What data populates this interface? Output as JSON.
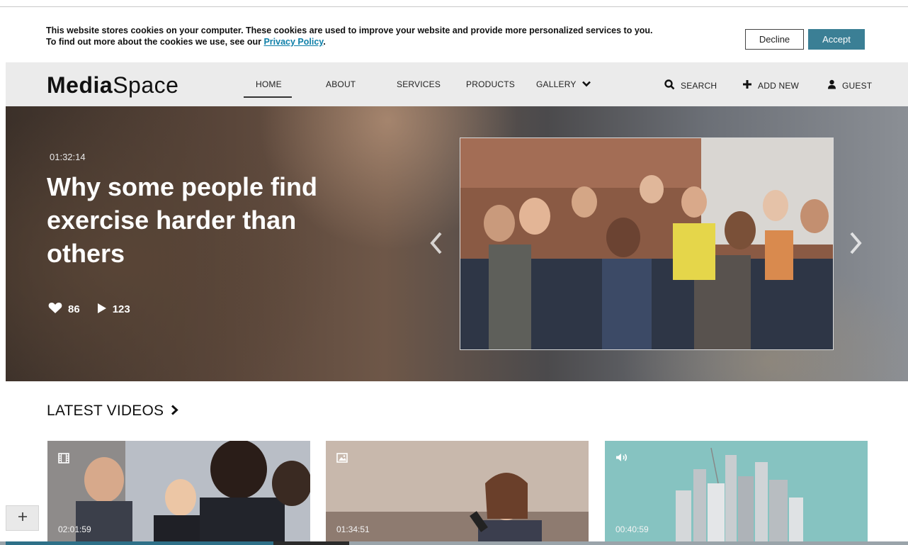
{
  "cookie": {
    "line1": "This website stores cookies on your computer. These cookies are used to improve your website and provide more personalized services to you.",
    "line2_prefix": "To find out more about the cookies we use, see our ",
    "policy_link": "Privacy Policy",
    "line2_suffix": ".",
    "decline_label": "Decline",
    "accept_label": "Accept",
    "accent_color": "#3b7f95"
  },
  "nav": {
    "logo_bold": "Media",
    "logo_light": "Space",
    "items": {
      "home": "HOME",
      "about": "ABOUT",
      "services": "SERVICES",
      "products": "PRODUCTS",
      "gallery": "GALLERY"
    },
    "search_label": "SEARCH",
    "add_new_label": "ADD NEW",
    "guest_label": "GUEST",
    "active_item": "HOME"
  },
  "hero": {
    "duration": "01:32:14",
    "title": "Why some people find exercise harder than others",
    "likes": "86",
    "plays": "123"
  },
  "latest": {
    "title": "LATEST VIDEOS",
    "cards": [
      {
        "type_icon": "film-icon",
        "duration": "02:01:59"
      },
      {
        "type_icon": "image-icon",
        "duration": "01:34:51"
      },
      {
        "type_icon": "audio-icon",
        "duration": "00:40:59"
      }
    ]
  },
  "colors": {
    "nav_bg": "#ebebeb",
    "link": "#0e7fa8",
    "progress_active": "#2e7088"
  }
}
